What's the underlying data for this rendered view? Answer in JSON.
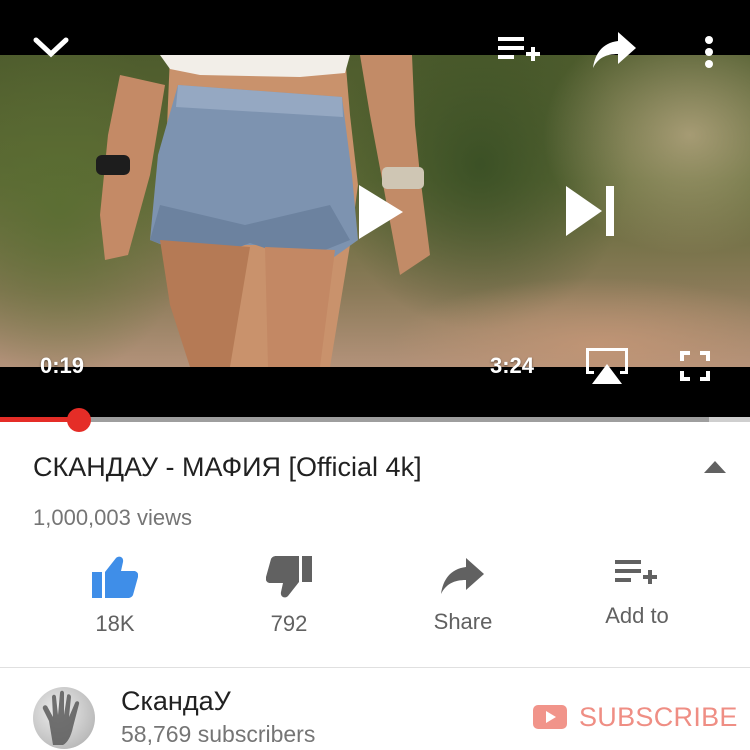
{
  "player": {
    "current_time": "0:19",
    "duration": "3:24",
    "played_fraction": 0.105,
    "buffered_fraction": 0.945,
    "icons": {
      "minimize": "chevron-down-icon",
      "add_to_queue": "playlist-add-icon",
      "share": "share-icon",
      "more": "more-vert-icon",
      "play": "play-icon",
      "next": "skip-next-icon",
      "airplay": "airplay-icon",
      "fullscreen": "fullscreen-icon"
    }
  },
  "video": {
    "title": "СКАНДАУ - МАФИЯ [Official 4k]",
    "views": "1,000,003 views"
  },
  "actions": {
    "like": {
      "label": "18K",
      "icon": "thumbs-up-icon",
      "color": "#3f8ee8"
    },
    "dislike": {
      "label": "792",
      "icon": "thumbs-down-icon"
    },
    "share": {
      "label": "Share",
      "icon": "share-icon"
    },
    "add_to": {
      "label": "Add to",
      "icon": "playlist-add-icon"
    }
  },
  "channel": {
    "name": "СкандаУ",
    "subscribers": "58,769 subscribers",
    "subscribe_label": "SUBSCRIBE",
    "subscribe_color": "#ef8e84"
  }
}
